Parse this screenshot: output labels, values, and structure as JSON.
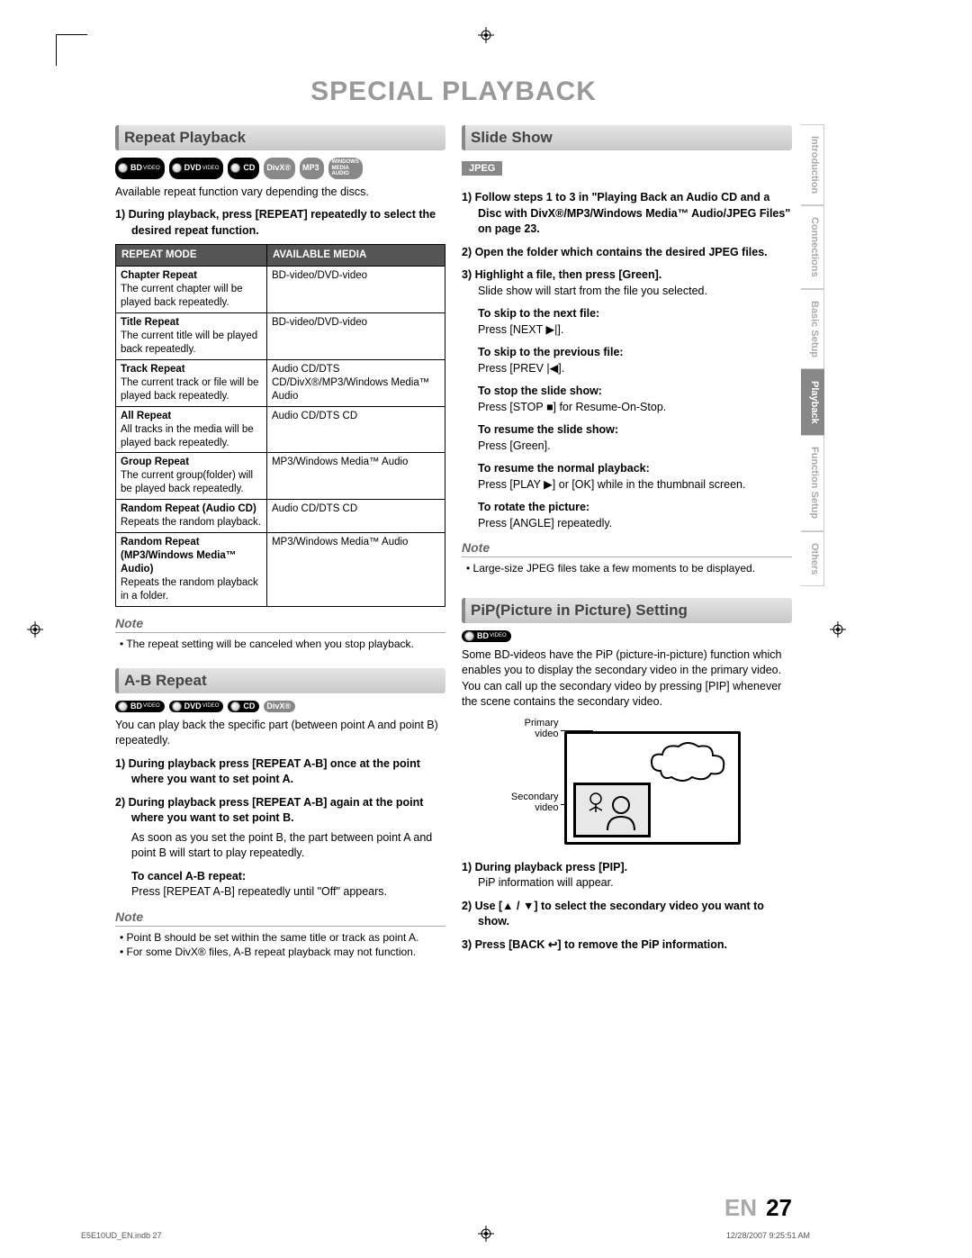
{
  "title": "SPECIAL PLAYBACK",
  "sections": {
    "repeat": {
      "heading": "Repeat Playback",
      "badges": [
        "BD VIDEO",
        "DVD VIDEO",
        "CD",
        "DivX®",
        "MP3",
        "WINDOWS MEDIA AUDIO"
      ],
      "intro": "Available repeat function vary depending the discs.",
      "step1": "1) During playback, press [REPEAT] repeatedly to select the desired repeat function.",
      "table": {
        "headers": [
          "REPEAT MODE",
          "AVAILABLE MEDIA"
        ],
        "rows": [
          {
            "mode": "Chapter Repeat",
            "desc": "The current chapter will be played back repeatedly.",
            "media": "BD-video/DVD-video"
          },
          {
            "mode": "Title Repeat",
            "desc": "The current title will be played back repeatedly.",
            "media": "BD-video/DVD-video"
          },
          {
            "mode": "Track Repeat",
            "desc": "The current track or file will be played back repeatedly.",
            "media": "Audio CD/DTS CD/DivX®/MP3/Windows Media™ Audio"
          },
          {
            "mode": "All Repeat",
            "desc": "All tracks in the media will be played back repeatedly.",
            "media": "Audio CD/DTS CD"
          },
          {
            "mode": "Group Repeat",
            "desc": "The current group(folder) will be played back repeatedly.",
            "media": "MP3/Windows Media™ Audio"
          },
          {
            "mode": "Random Repeat (Audio CD)",
            "desc": "Repeats the random playback.",
            "media": "Audio CD/DTS CD"
          },
          {
            "mode": "Random Repeat (MP3/Windows Media™ Audio)",
            "desc": "Repeats the random playback in a folder.",
            "media": "MP3/Windows Media™ Audio"
          }
        ]
      },
      "note_hdr": "Note",
      "note": "The repeat setting will be canceled when you stop playback."
    },
    "ab": {
      "heading": "A-B Repeat",
      "badges": [
        "BD VIDEO",
        "DVD VIDEO",
        "CD",
        "DivX®"
      ],
      "intro": "You can play back the specific part (between point A and point B) repeatedly.",
      "step1": "1) During playback press [REPEAT A-B] once at the point where you want to set point A.",
      "step2": "2) During playback press [REPEAT A-B] again at the point where you want to set point B.",
      "step2_sub": "As soon as you set the point B, the part between point A and point B will start to play repeatedly.",
      "cancel_hdr": "To cancel A-B repeat:",
      "cancel_body": "Press [REPEAT A-B] repeatedly until \"Off\" appears.",
      "note_hdr": "Note",
      "note1": "Point B should be set within the same title or track as point A.",
      "note2": "For some DivX® files, A-B repeat playback may not function."
    },
    "slide": {
      "heading": "Slide Show",
      "jpeg": "JPEG",
      "step1": "1) Follow steps 1 to 3 in \"Playing Back an Audio CD and a Disc with DivX®/MP3/Windows Media™ Audio/JPEG Files\" on page 23.",
      "step2": "2) Open the folder which contains the desired JPEG files.",
      "step3": "3) Highlight a file, then press [Green].",
      "step3_sub": "Slide show will start from the file you selected.",
      "items": [
        {
          "h": "To skip to the next file:",
          "b": "Press [NEXT ▶|]."
        },
        {
          "h": "To skip to the previous file:",
          "b": "Press [PREV |◀]."
        },
        {
          "h": "To stop the slide show:",
          "b": "Press [STOP ■] for Resume-On-Stop."
        },
        {
          "h": "To resume the slide show:",
          "b": "Press [Green]."
        },
        {
          "h": "To resume the normal playback:",
          "b": "Press [PLAY ▶] or [OK] while in the thumbnail screen."
        },
        {
          "h": "To rotate the picture:",
          "b": "Press [ANGLE] repeatedly."
        }
      ],
      "note_hdr": "Note",
      "note": "Large-size JPEG files take a few moments to be displayed."
    },
    "pip": {
      "heading": "PiP(Picture in Picture) Setting",
      "badges": [
        "BD VIDEO"
      ],
      "intro": "Some BD-videos have the PiP (picture-in-picture) function which enables you to display the secondary video in the primary video. You can call up the secondary video by pressing [PIP] whenever the scene contains the secondary video.",
      "lbl_primary": "Primary video",
      "lbl_secondary": "Secondary video",
      "step1": "1) During playback press [PIP].",
      "step1_sub": "PiP information will appear.",
      "step2": "2) Use [▲ / ▼] to select the secondary video you want to show.",
      "step3": "3) Press [BACK ↩] to remove the PiP information."
    }
  },
  "tabs": [
    "Introduction",
    "Connections",
    "Basic Setup",
    "Playback",
    "Function Setup",
    "Others"
  ],
  "active_tab": "Playback",
  "footer": {
    "lang": "EN",
    "page": "27"
  },
  "meta": {
    "left": "E5E10UD_EN.indb   27",
    "right": "12/28/2007   9:25:51 AM"
  }
}
